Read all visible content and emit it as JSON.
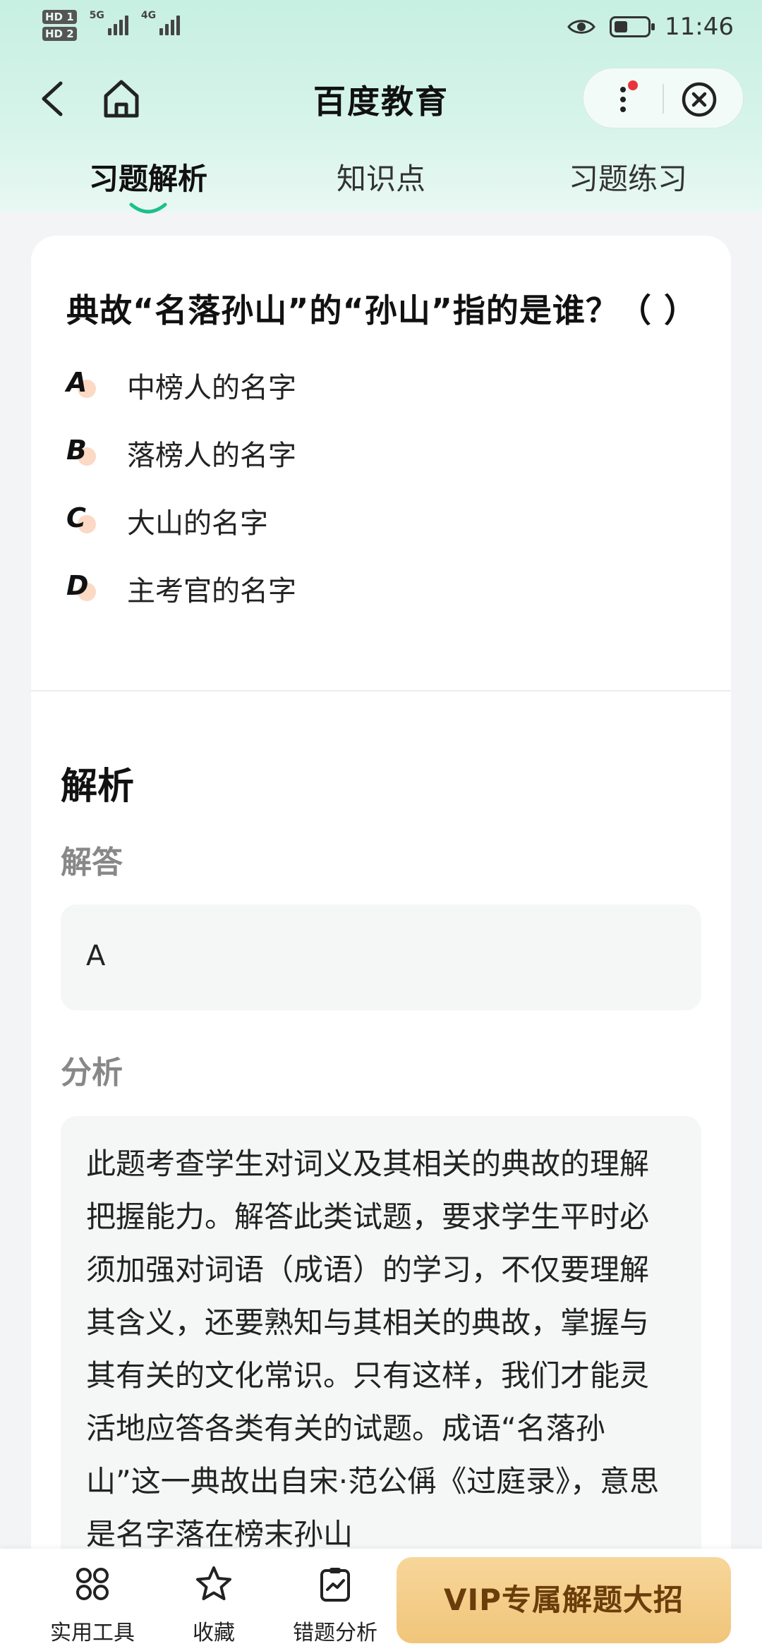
{
  "status_bar": {
    "hd1": "HD 1",
    "hd2": "HD 2",
    "network1": "5G",
    "network2": "4G",
    "time": "11:46",
    "icons": [
      "eye-icon",
      "battery-icon"
    ]
  },
  "nav": {
    "title": "百度教育",
    "icons": [
      "back-icon",
      "home-icon",
      "more-icon",
      "close-icon"
    ],
    "notification_dot_color": "#e8343c"
  },
  "tabs": [
    {
      "label": "习题解析",
      "active": true
    },
    {
      "label": "知识点",
      "active": false
    },
    {
      "label": "习题练习",
      "active": false
    }
  ],
  "question": {
    "text": "典故“名落孙山”的“孙山”指的是谁？（ ）",
    "options": [
      {
        "letter": "A",
        "text": "中榜人的名字"
      },
      {
        "letter": "B",
        "text": "落榜人的名字"
      },
      {
        "letter": "C",
        "text": "大山的名字"
      },
      {
        "letter": "D",
        "text": "主考官的名字"
      }
    ]
  },
  "explanation": {
    "title": "解析",
    "answer_label": "解答",
    "answer_value": "A",
    "analysis_label": "分析",
    "analysis_text": "此题考查学生对词义及其相关的典故的理解把握能力。解答此类试题，要求学生平时必须加强对词语（成语）的学习，不仅要理解其含义，还要熟知与其相关的典故，掌握与其有关的文化常识。只有这样，我们才能灵活地应答各类有关的试题。成语“名落孙山”这一典故出自宋·范公偁《过庭录》，意思是名字落在榜末孙山"
  },
  "bottom_bar": {
    "tools": [
      {
        "label": "实用工具",
        "icon": "grid-icon"
      },
      {
        "label": "收藏",
        "icon": "star-icon"
      },
      {
        "label": "错题分析",
        "icon": "clipboard-chart-icon"
      }
    ],
    "vip_label": "VIP专属解题大招"
  },
  "colors": {
    "header_bg": "#c7efe2",
    "accent_green": "#1dbf8a",
    "vip_gold": "#f1c57a",
    "vip_text": "#6a3d0a"
  }
}
